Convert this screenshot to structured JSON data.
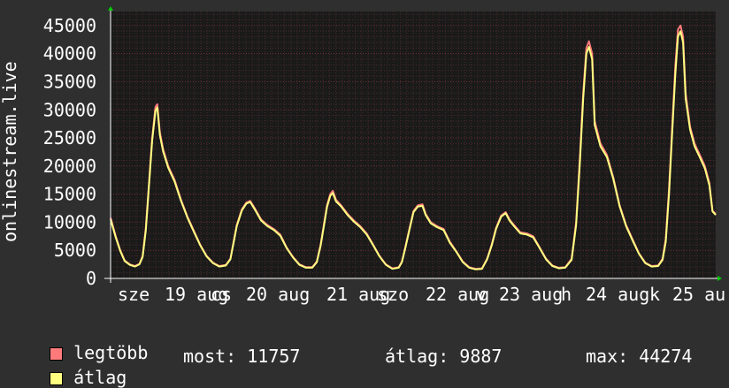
{
  "chart_data": {
    "type": "line",
    "ylabel": "onlinestream.live",
    "ylim": [
      0,
      47500
    ],
    "yticks": [
      0,
      5000,
      10000,
      15000,
      20000,
      25000,
      30000,
      35000,
      40000,
      45000
    ],
    "xlim": [
      0,
      7.0
    ],
    "xticks": [
      {
        "x": 0.7,
        "label": "sze"
      },
      {
        "x": 1.0,
        "label": "19 aug"
      },
      {
        "x": 1.2,
        "label": "cs"
      },
      {
        "x": 2.0,
        "label": "20 aug"
      },
      {
        "x": 3.0,
        "label": "21 aug"
      },
      {
        "x": 3.1,
        "label": "szo"
      },
      {
        "x": 4.0,
        "label": "22 aug"
      },
      {
        "x": 4.15,
        "label": "v"
      },
      {
        "x": 5.0,
        "label": "23 aug"
      },
      {
        "x": 5.2,
        "label": "h"
      },
      {
        "x": 6.0,
        "label": "24 aug"
      },
      {
        "x": 6.1,
        "label": "k"
      },
      {
        "x": 7.0,
        "label": "25 au"
      }
    ],
    "grid": true,
    "series": [
      {
        "name": "legtöbb",
        "color": "#ff7b7b",
        "points": [
          [
            0.0,
            10800
          ],
          [
            0.08,
            7500
          ],
          [
            0.15,
            5000
          ],
          [
            0.22,
            3200
          ],
          [
            0.3,
            2500
          ],
          [
            0.38,
            2200
          ],
          [
            0.45,
            2600
          ],
          [
            0.5,
            4000
          ],
          [
            0.55,
            9000
          ],
          [
            0.6,
            17000
          ],
          [
            0.65,
            25000
          ],
          [
            0.7,
            30500
          ],
          [
            0.73,
            31000
          ],
          [
            0.77,
            26000
          ],
          [
            0.82,
            23000
          ],
          [
            0.9,
            20000
          ],
          [
            1.0,
            17500
          ],
          [
            1.1,
            14000
          ],
          [
            1.2,
            11000
          ],
          [
            1.3,
            8500
          ],
          [
            1.4,
            6000
          ],
          [
            1.5,
            4000
          ],
          [
            1.6,
            2800
          ],
          [
            1.7,
            2200
          ],
          [
            1.8,
            2400
          ],
          [
            1.87,
            3500
          ],
          [
            1.92,
            6500
          ],
          [
            1.97,
            9500
          ],
          [
            2.05,
            12300
          ],
          [
            2.12,
            13500
          ],
          [
            2.18,
            13800
          ],
          [
            2.25,
            12500
          ],
          [
            2.35,
            10500
          ],
          [
            2.45,
            9500
          ],
          [
            2.55,
            8800
          ],
          [
            2.65,
            7800
          ],
          [
            2.75,
            5500
          ],
          [
            2.85,
            3800
          ],
          [
            2.95,
            2500
          ],
          [
            3.05,
            2000
          ],
          [
            3.15,
            2000
          ],
          [
            3.22,
            3000
          ],
          [
            3.28,
            6000
          ],
          [
            3.33,
            9500
          ],
          [
            3.38,
            13000
          ],
          [
            3.43,
            15000
          ],
          [
            3.47,
            15600
          ],
          [
            3.52,
            14000
          ],
          [
            3.6,
            13000
          ],
          [
            3.7,
            11500
          ],
          [
            3.8,
            10300
          ],
          [
            3.9,
            9300
          ],
          [
            4.0,
            8000
          ],
          [
            4.1,
            6000
          ],
          [
            4.2,
            4000
          ],
          [
            4.3,
            2500
          ],
          [
            4.4,
            1800
          ],
          [
            4.5,
            2000
          ],
          [
            4.55,
            3000
          ],
          [
            4.6,
            5500
          ],
          [
            4.67,
            9000
          ],
          [
            4.73,
            12000
          ],
          [
            4.8,
            13000
          ],
          [
            4.87,
            13200
          ],
          [
            4.92,
            11500
          ],
          [
            5.0,
            10000
          ],
          [
            5.1,
            9300
          ],
          [
            5.2,
            8800
          ],
          [
            5.3,
            6500
          ],
          [
            5.4,
            4800
          ],
          [
            5.5,
            3000
          ],
          [
            5.6,
            2000
          ],
          [
            5.7,
            1700
          ],
          [
            5.8,
            1800
          ],
          [
            5.88,
            3500
          ],
          [
            5.95,
            6000
          ],
          [
            6.02,
            9000
          ],
          [
            6.1,
            11200
          ],
          [
            6.17,
            11800
          ],
          [
            6.23,
            10500
          ],
          [
            6.3,
            9500
          ],
          [
            6.4,
            8200
          ],
          [
            6.5,
            8000
          ],
          [
            6.6,
            7500
          ],
          [
            6.7,
            5500
          ],
          [
            6.8,
            3500
          ],
          [
            6.9,
            2300
          ],
          [
            7.0,
            1900
          ],
          [
            7.1,
            2000
          ],
          [
            7.2,
            3500
          ],
          [
            7.27,
            10000
          ],
          [
            7.33,
            22000
          ],
          [
            7.38,
            33000
          ],
          [
            7.43,
            41000
          ],
          [
            7.47,
            42200
          ],
          [
            7.52,
            40000
          ],
          [
            7.56,
            28000
          ],
          [
            7.65,
            24000
          ],
          [
            7.75,
            22000
          ],
          [
            7.85,
            18000
          ],
          [
            7.95,
            13000
          ],
          [
            8.05,
            9500
          ],
          [
            8.15,
            7000
          ],
          [
            8.25,
            4500
          ],
          [
            8.35,
            2800
          ],
          [
            8.45,
            2200
          ],
          [
            8.55,
            2300
          ],
          [
            8.62,
            3500
          ],
          [
            8.67,
            7000
          ],
          [
            8.72,
            16000
          ],
          [
            8.77,
            27000
          ],
          [
            8.82,
            38000
          ],
          [
            8.86,
            44274
          ],
          [
            8.9,
            45000
          ],
          [
            8.94,
            43000
          ],
          [
            8.98,
            33000
          ],
          [
            9.05,
            27000
          ],
          [
            9.12,
            24000
          ],
          [
            9.2,
            22000
          ],
          [
            9.28,
            20000
          ],
          [
            9.35,
            17000
          ],
          [
            9.4,
            12000
          ],
          [
            9.45,
            11500
          ]
        ]
      },
      {
        "name": "átlag",
        "color": "#ffff80",
        "points": [
          [
            0.0,
            10500
          ],
          [
            0.08,
            7300
          ],
          [
            0.15,
            4900
          ],
          [
            0.22,
            3100
          ],
          [
            0.3,
            2400
          ],
          [
            0.38,
            2100
          ],
          [
            0.45,
            2500
          ],
          [
            0.5,
            3800
          ],
          [
            0.55,
            8500
          ],
          [
            0.6,
            16500
          ],
          [
            0.65,
            24500
          ],
          [
            0.7,
            29800
          ],
          [
            0.73,
            30400
          ],
          [
            0.77,
            25500
          ],
          [
            0.82,
            22600
          ],
          [
            0.9,
            19700
          ],
          [
            1.0,
            17200
          ],
          [
            1.1,
            13800
          ],
          [
            1.2,
            10800
          ],
          [
            1.3,
            8300
          ],
          [
            1.4,
            5900
          ],
          [
            1.5,
            3900
          ],
          [
            1.6,
            2700
          ],
          [
            1.7,
            2100
          ],
          [
            1.8,
            2300
          ],
          [
            1.87,
            3400
          ],
          [
            1.92,
            6300
          ],
          [
            1.97,
            9300
          ],
          [
            2.05,
            12100
          ],
          [
            2.12,
            13300
          ],
          [
            2.18,
            13600
          ],
          [
            2.25,
            12300
          ],
          [
            2.35,
            10300
          ],
          [
            2.45,
            9300
          ],
          [
            2.55,
            8600
          ],
          [
            2.65,
            7600
          ],
          [
            2.75,
            5400
          ],
          [
            2.85,
            3700
          ],
          [
            2.95,
            2400
          ],
          [
            3.05,
            1900
          ],
          [
            3.15,
            1900
          ],
          [
            3.22,
            2900
          ],
          [
            3.28,
            5800
          ],
          [
            3.33,
            9200
          ],
          [
            3.38,
            12700
          ],
          [
            3.43,
            14700
          ],
          [
            3.47,
            15200
          ],
          [
            3.52,
            13700
          ],
          [
            3.6,
            12800
          ],
          [
            3.7,
            11300
          ],
          [
            3.8,
            10100
          ],
          [
            3.9,
            9100
          ],
          [
            4.0,
            7800
          ],
          [
            4.1,
            5900
          ],
          [
            4.2,
            3900
          ],
          [
            4.3,
            2400
          ],
          [
            4.4,
            1700
          ],
          [
            4.5,
            1900
          ],
          [
            4.55,
            2900
          ],
          [
            4.6,
            5300
          ],
          [
            4.67,
            8800
          ],
          [
            4.73,
            11800
          ],
          [
            4.8,
            12800
          ],
          [
            4.87,
            12900
          ],
          [
            4.92,
            11300
          ],
          [
            5.0,
            9800
          ],
          [
            5.1,
            9100
          ],
          [
            5.2,
            8600
          ],
          [
            5.3,
            6300
          ],
          [
            5.4,
            4700
          ],
          [
            5.5,
            2900
          ],
          [
            5.6,
            1900
          ],
          [
            5.7,
            1600
          ],
          [
            5.8,
            1700
          ],
          [
            5.88,
            3400
          ],
          [
            5.95,
            5800
          ],
          [
            6.02,
            8800
          ],
          [
            6.1,
            11000
          ],
          [
            6.17,
            11600
          ],
          [
            6.23,
            10300
          ],
          [
            6.3,
            9300
          ],
          [
            6.4,
            8000
          ],
          [
            6.5,
            7800
          ],
          [
            6.6,
            7300
          ],
          [
            6.7,
            5400
          ],
          [
            6.8,
            3400
          ],
          [
            6.9,
            2200
          ],
          [
            7.0,
            1800
          ],
          [
            7.1,
            1900
          ],
          [
            7.2,
            3300
          ],
          [
            7.27,
            9500
          ],
          [
            7.33,
            21000
          ],
          [
            7.38,
            32000
          ],
          [
            7.43,
            40000
          ],
          [
            7.47,
            41200
          ],
          [
            7.52,
            39000
          ],
          [
            7.56,
            27300
          ],
          [
            7.65,
            23500
          ],
          [
            7.75,
            21600
          ],
          [
            7.85,
            17700
          ],
          [
            7.95,
            12800
          ],
          [
            8.05,
            9300
          ],
          [
            8.15,
            6800
          ],
          [
            8.25,
            4400
          ],
          [
            8.35,
            2700
          ],
          [
            8.45,
            2100
          ],
          [
            8.55,
            2200
          ],
          [
            8.62,
            3300
          ],
          [
            8.67,
            6500
          ],
          [
            8.72,
            15000
          ],
          [
            8.77,
            26000
          ],
          [
            8.82,
            36500
          ],
          [
            8.86,
            43000
          ],
          [
            8.9,
            44000
          ],
          [
            8.94,
            42000
          ],
          [
            8.98,
            32000
          ],
          [
            9.05,
            26500
          ],
          [
            9.12,
            23500
          ],
          [
            9.2,
            21600
          ],
          [
            9.28,
            19600
          ],
          [
            9.35,
            16600
          ],
          [
            9.4,
            11900
          ],
          [
            9.45,
            11300
          ]
        ]
      }
    ]
  },
  "legend": {
    "max_label": "legtöbb",
    "avg_label": "átlag",
    "max_color": "#ff7b7b",
    "avg_color": "#ffff80"
  },
  "stats": {
    "now": "most: 11757",
    "avg": "átlag: 9887",
    "max": "max: 44274"
  }
}
